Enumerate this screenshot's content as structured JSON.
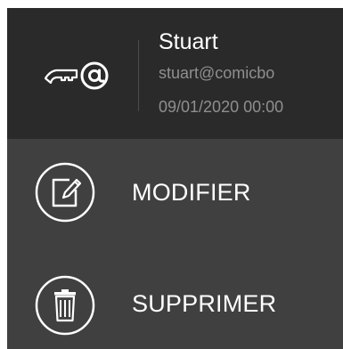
{
  "account": {
    "icon": "key-at-icon",
    "name": "Stuart",
    "email": "stuart@comicbo",
    "datetime": "09/01/2020 00:00"
  },
  "menu": [
    {
      "label": "MODIFIER",
      "icon": "edit-icon"
    },
    {
      "label": "SUPPRIMER",
      "icon": "trash-icon"
    }
  ],
  "colors": {
    "header_bg": "#2a2a2a",
    "menu_bg": "#404040",
    "text_primary": "#ffffff",
    "text_secondary": "#8f8f8f"
  }
}
